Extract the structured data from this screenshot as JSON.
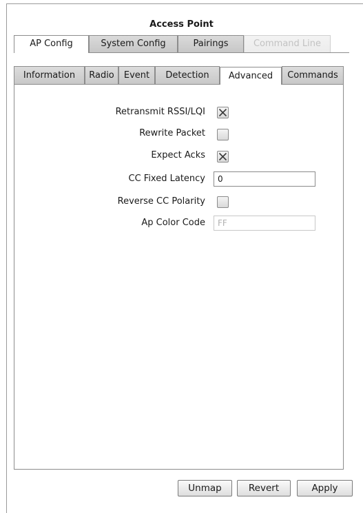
{
  "title": "Access Point",
  "top_tabs": [
    {
      "label": "AP Config",
      "state": "active"
    },
    {
      "label": "System Config",
      "state": "normal"
    },
    {
      "label": "Pairings",
      "state": "normal"
    },
    {
      "label": "Command Line",
      "state": "disabled"
    }
  ],
  "sub_tabs": [
    {
      "label": "Information",
      "state": "normal"
    },
    {
      "label": "Radio",
      "state": "normal"
    },
    {
      "label": "Event",
      "state": "normal"
    },
    {
      "label": "Detection",
      "state": "normal"
    },
    {
      "label": "Advanced",
      "state": "active"
    },
    {
      "label": "Commands",
      "state": "normal"
    }
  ],
  "fields": {
    "retransmit": {
      "label": "Retransmit RSSI/LQI",
      "checked": true
    },
    "rewrite": {
      "label": "Rewrite Packet",
      "checked": false
    },
    "expect_acks": {
      "label": "Expect Acks",
      "checked": true
    },
    "cc_latency": {
      "label": "CC Fixed Latency",
      "value": "0"
    },
    "reverse_cc": {
      "label": "Reverse CC Polarity",
      "checked": false
    },
    "ap_color": {
      "label": "Ap Color Code",
      "value": "FF",
      "disabled": true
    }
  },
  "buttons": {
    "unmap": "Unmap",
    "revert": "Revert",
    "apply": "Apply"
  }
}
